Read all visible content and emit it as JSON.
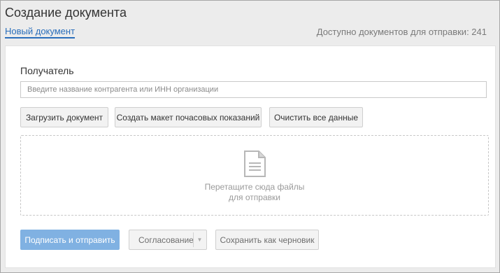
{
  "header": {
    "title": "Создание документа",
    "new_doc_link": "Новый документ",
    "available_text": "Доступно документов для отправки: 241"
  },
  "recipient": {
    "label": "Получатель",
    "placeholder": "Введите название контрагента или ИНН организации"
  },
  "actions": {
    "upload": "Загрузить документ",
    "create_template": "Создать макет почасовых показаний",
    "clear": "Очистить все данные"
  },
  "dropzone": {
    "line1": "Перетащите сюда файлы",
    "line2": "для отправки",
    "icon": "document-icon"
  },
  "footer": {
    "sign_send": "Подписать и отправить",
    "approval": "Согласование",
    "approval_arrow": "▼",
    "save_draft": "Сохранить как черновик"
  },
  "colors": {
    "link": "#2a6ebb",
    "primary_button": "#80b1e2",
    "background": "#ececec"
  }
}
